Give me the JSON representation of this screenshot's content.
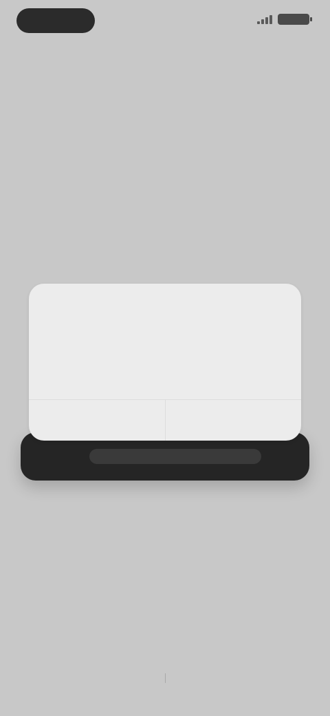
{
  "status_bar": {
    "logo_label": ""
  },
  "heading": "",
  "card": {
    "title": "",
    "body": "",
    "actions": [
      {
        "label": ""
      },
      {
        "label": ""
      }
    ]
  },
  "footer": {
    "links": [
      {
        "label": ""
      },
      {
        "label": ""
      }
    ]
  },
  "colors": {
    "background": "#c8c8c8",
    "card": "#ececec",
    "dark_bar": "#252525"
  }
}
